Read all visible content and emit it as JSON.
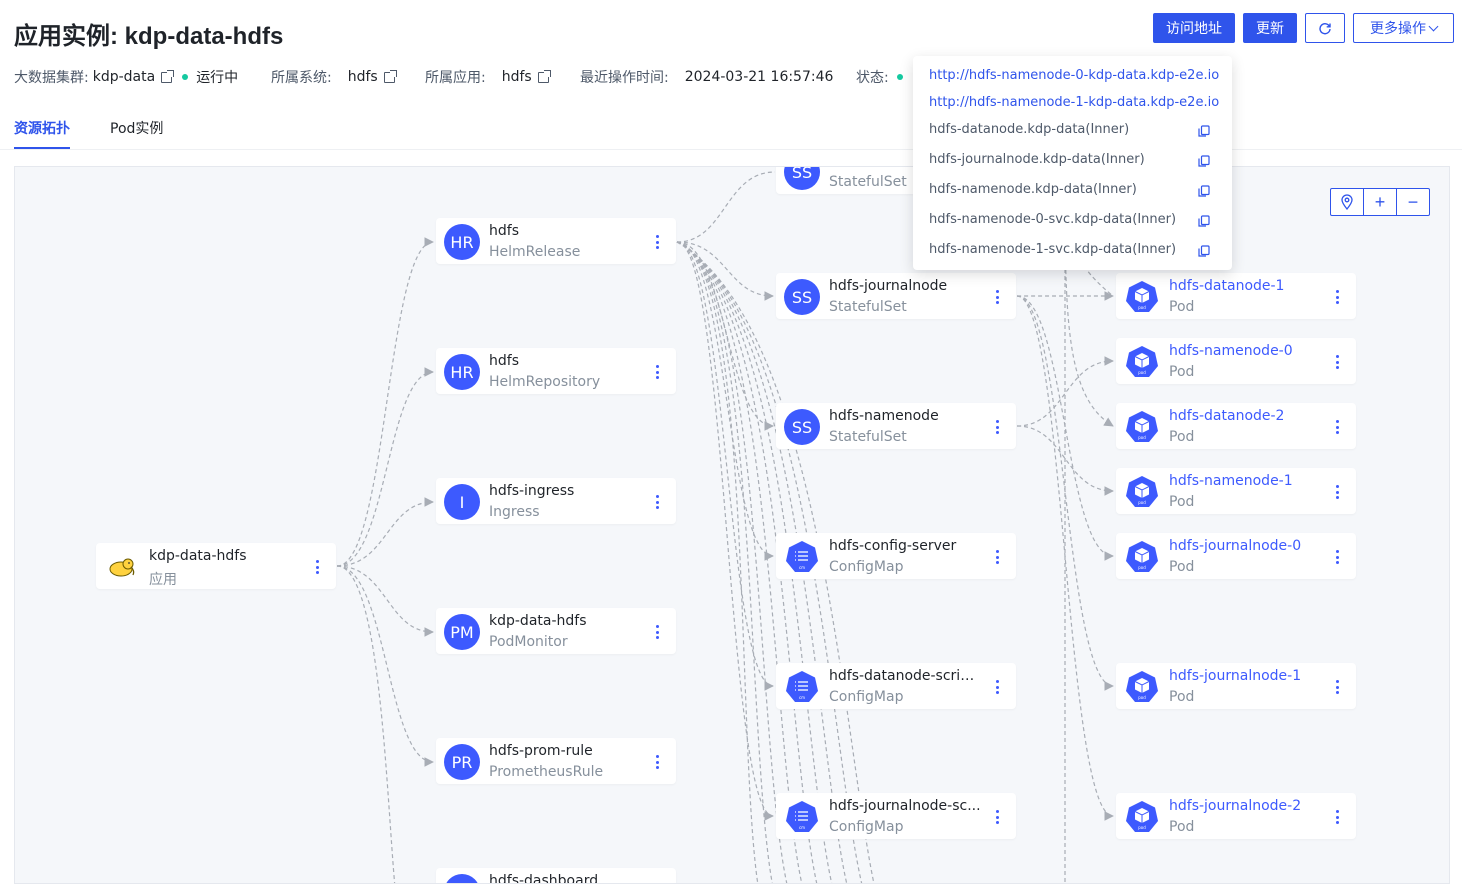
{
  "title": "应用实例: kdp-data-hdfs",
  "buttons": {
    "visit": "访问地址",
    "update": "更新",
    "more": "更多操作"
  },
  "meta": {
    "cluster_label": "大数据集群:",
    "cluster_value": "kdp-data",
    "cluster_status": "运行中",
    "system_label": "所属系统:",
    "system_value": "hdfs",
    "app_label": "所属应用:",
    "app_value": "hdfs",
    "time_label": "最近操作时间:",
    "time_value": "2024-03-21 16:57:46",
    "status_label": "状态:"
  },
  "tabs": [
    {
      "label": "资源拓扑"
    },
    {
      "label": "Pod实例"
    }
  ],
  "access_urls": {
    "links": [
      "http://hdfs-namenode-0-kdp-data.kdp-e2e.io",
      "http://hdfs-namenode-1-kdp-data.kdp-e2e.io"
    ],
    "inner": [
      "hdfs-datanode.kdp-data(Inner)",
      "hdfs-journalnode.kdp-data(Inner)",
      "hdfs-namenode.kdp-data(Inner)",
      "hdfs-namenode-0-svc.kdp-data(Inner)",
      "hdfs-namenode-1-svc.kdp-data(Inner)"
    ]
  },
  "colors": {
    "primary": "#2f54eb",
    "avatar": "#3d5afe",
    "status_running": "#14c9a0",
    "canvas_bg": "#f5f7fa"
  },
  "topology": {
    "root": {
      "name": "kdp-data-hdfs",
      "kind": "应用",
      "icon": "hadoop-elephant-icon"
    },
    "level1": [
      {
        "abbr": "HR",
        "name": "hdfs",
        "kind": "HelmRelease"
      },
      {
        "abbr": "HR",
        "name": "hdfs",
        "kind": "HelmRepository"
      },
      {
        "abbr": "I",
        "name": "hdfs-ingress",
        "kind": "Ingress"
      },
      {
        "abbr": "PM",
        "name": "kdp-data-hdfs",
        "kind": "PodMonitor"
      },
      {
        "abbr": "PR",
        "name": "hdfs-prom-rule",
        "kind": "PrometheusRule"
      },
      {
        "abbr": "",
        "name": "hdfs-dashboard",
        "kind": ""
      }
    ],
    "level2": [
      {
        "abbr": "SS",
        "name": "",
        "kind": "StatefulSet"
      },
      {
        "abbr": "SS",
        "name": "hdfs-journalnode",
        "kind": "StatefulSet"
      },
      {
        "abbr": "SS",
        "name": "hdfs-namenode",
        "kind": "StatefulSet"
      },
      {
        "icon": "configmap-icon",
        "name": "hdfs-config-server",
        "kind": "ConfigMap"
      },
      {
        "icon": "configmap-icon",
        "name": "hdfs-datanode-scripts",
        "kind": "ConfigMap"
      },
      {
        "icon": "configmap-icon",
        "name": "hdfs-journalnode-sc...",
        "kind": "ConfigMap"
      }
    ],
    "pods": [
      {
        "name": "hdfs-datanode-1",
        "kind": "Pod"
      },
      {
        "name": "hdfs-namenode-0",
        "kind": "Pod"
      },
      {
        "name": "hdfs-datanode-2",
        "kind": "Pod"
      },
      {
        "name": "hdfs-namenode-1",
        "kind": "Pod"
      },
      {
        "name": "hdfs-journalnode-0",
        "kind": "Pod"
      },
      {
        "name": "hdfs-journalnode-1",
        "kind": "Pod"
      },
      {
        "name": "hdfs-journalnode-2",
        "kind": "Pod"
      }
    ]
  }
}
